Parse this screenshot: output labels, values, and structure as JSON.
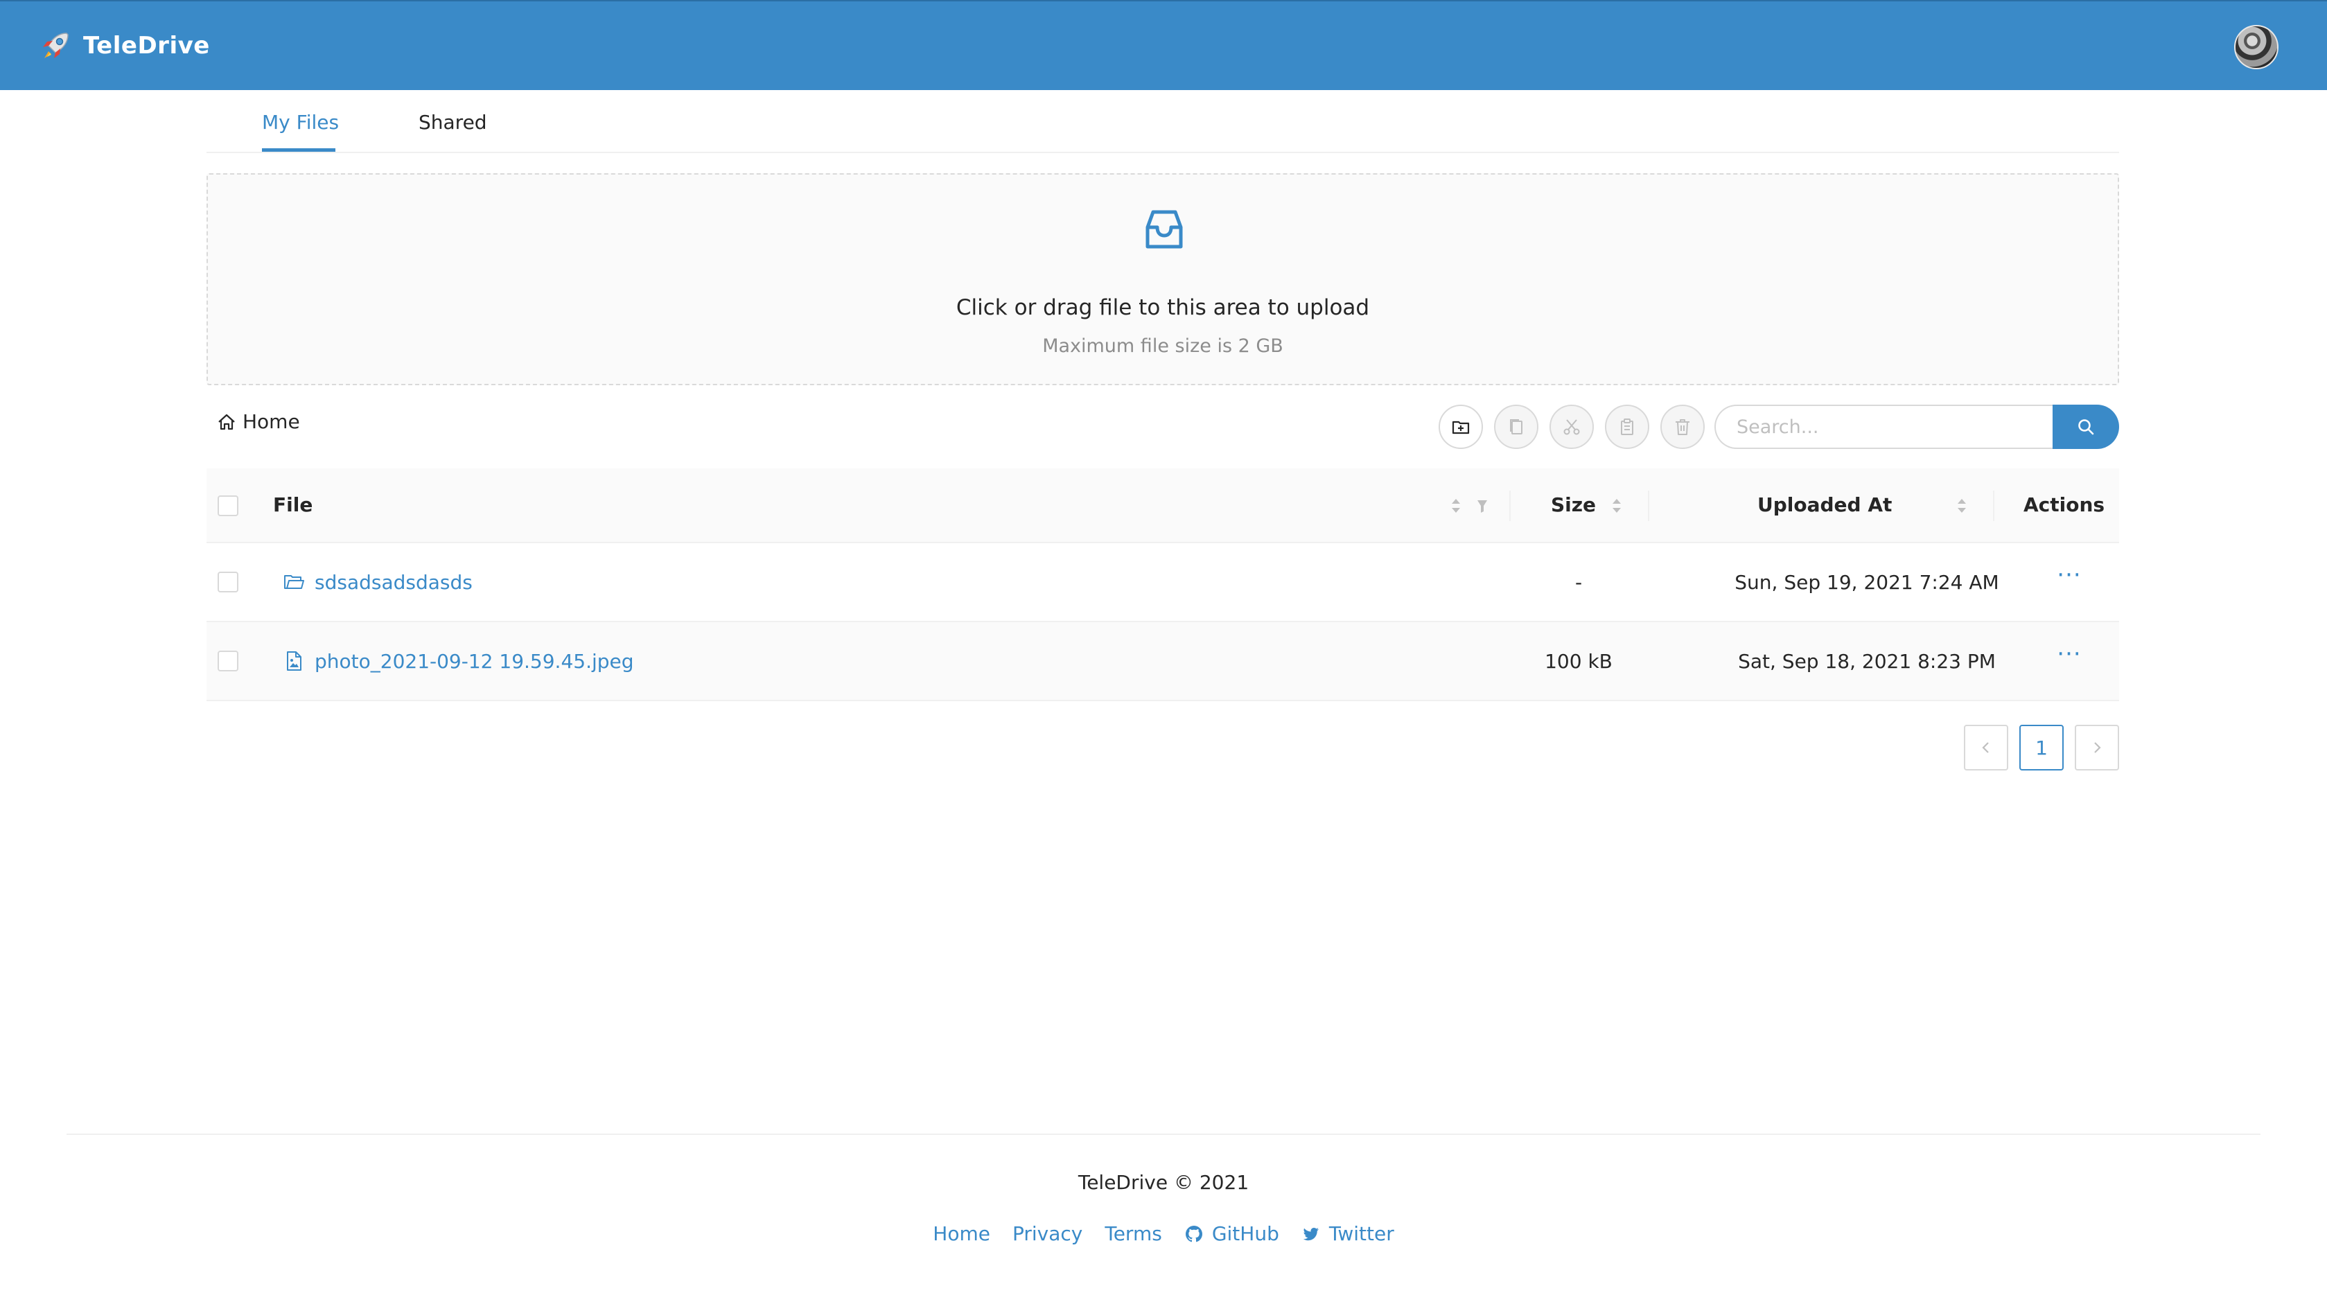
{
  "header": {
    "app_name": "TeleDrive",
    "logo_icon": "rocket-icon",
    "avatar_icon": "user-avatar",
    "brand_color": "#3a8ac8"
  },
  "tabs": [
    {
      "label": "My Files",
      "active": true
    },
    {
      "label": "Shared",
      "active": false
    }
  ],
  "upload": {
    "icon": "inbox-icon",
    "title": "Click or drag file to this area to upload",
    "hint": "Maximum file size is 2 GB"
  },
  "breadcrumb": {
    "label": "Home",
    "icon": "home-icon"
  },
  "toolbar": {
    "buttons": [
      {
        "icon": "new-folder-icon",
        "enabled": true
      },
      {
        "icon": "copy-icon",
        "enabled": false
      },
      {
        "icon": "scissors-icon",
        "enabled": false
      },
      {
        "icon": "paste-icon",
        "enabled": false
      },
      {
        "icon": "trash-icon",
        "enabled": false
      }
    ],
    "search_placeholder": "Search...",
    "search_icon": "search-icon"
  },
  "table": {
    "columns": {
      "file": "File",
      "size": "Size",
      "uploaded": "Uploaded At",
      "actions": "Actions"
    },
    "rows": [
      {
        "type": "folder",
        "icon": "folder-icon",
        "name": "sdsadsadsdasds",
        "size": "-",
        "uploaded": "Sun, Sep 19, 2021 7:24 AM",
        "actions": "···"
      },
      {
        "type": "file",
        "icon": "file-image-icon",
        "name": "photo_2021-09-12 19.59.45.jpeg",
        "size": "100 kB",
        "uploaded": "Sat, Sep 18, 2021 8:23 PM",
        "actions": "···"
      }
    ]
  },
  "pagination": {
    "current_page": "1"
  },
  "footer": {
    "copyright": "TeleDrive © 2021",
    "links": {
      "home": "Home",
      "privacy": "Privacy",
      "terms": "Terms",
      "github": "GitHub",
      "twitter": "Twitter"
    }
  }
}
